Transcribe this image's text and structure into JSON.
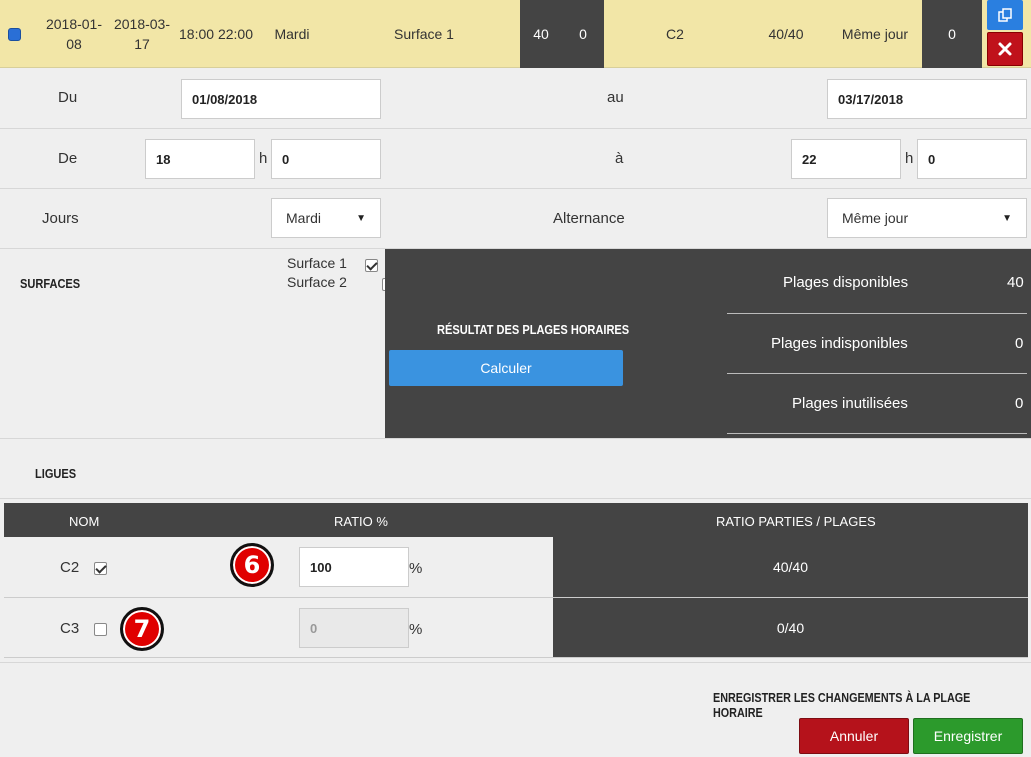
{
  "summary": {
    "start_date": "2018-01-08",
    "end_date": "2018-03-17",
    "time_range": "18:00 22:00",
    "day": "Mardi",
    "surface": "Surface 1",
    "available": "40",
    "unavailable": "0",
    "league": "C2",
    "ratio": "40/40",
    "alternance": "Même jour",
    "unused": "0"
  },
  "form": {
    "du_label": "Du",
    "du_value": "01/08/2018",
    "au_label": "au",
    "au_value": "03/17/2018",
    "de_label": "De",
    "de_hour": "18",
    "de_min": "0",
    "a_label": "à",
    "a_hour": "22",
    "a_min": "0",
    "h_label": "h",
    "jours_label": "Jours",
    "jours_value": "Mardi",
    "alternance_label": "Alternance",
    "alternance_value": "Même jour"
  },
  "surfaces": {
    "heading": "SURFACES",
    "items": [
      {
        "label": "Surface 1",
        "checked": true
      },
      {
        "label": "Surface 2",
        "checked": false
      }
    ]
  },
  "results": {
    "heading": "RÉSULTAT DES PLAGES HORAIRES",
    "calc_label": "Calculer",
    "stats": [
      {
        "label": "Plages disponibles",
        "value": "40"
      },
      {
        "label": "Plages indisponibles",
        "value": "0"
      },
      {
        "label": "Plages inutilisées",
        "value": "0"
      }
    ]
  },
  "leagues": {
    "heading": "LIGUES",
    "columns": [
      "NOM",
      "RATIO %",
      "RATIO PARTIES / PLAGES"
    ],
    "rows": [
      {
        "name": "C2",
        "checked": true,
        "ratio": "100",
        "percent": "%",
        "ratio_games": "40/40",
        "badge": "6"
      },
      {
        "name": "C3",
        "checked": false,
        "ratio": "0",
        "percent": "%",
        "ratio_games": "0/40",
        "badge": "7"
      }
    ]
  },
  "footer": {
    "heading": "ENREGISTRER LES CHANGEMENTS À LA PLAGE HORAIRE",
    "cancel_label": "Annuler",
    "save_label": "Enregistrer"
  },
  "colors": {
    "summary_bg": "#f2e6a7",
    "dark_panel": "#444444",
    "calc_blue": "#3a93e0",
    "cancel_red": "#b5121b",
    "save_green": "#2c9a2c"
  }
}
